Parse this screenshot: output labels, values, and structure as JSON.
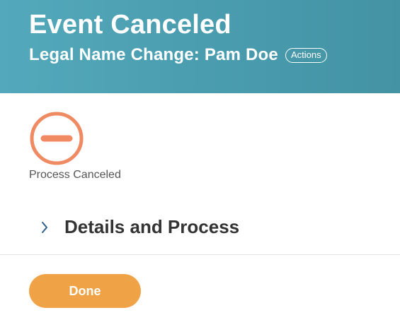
{
  "header": {
    "title": "Event Canceled",
    "subtitle": "Legal Name Change: Pam Doe",
    "actions_label": "Actions",
    "background_color": "#4a9daf"
  },
  "status": {
    "icon": "canceled-circle-icon",
    "icon_color": "#f08a63",
    "label": "Process Canceled"
  },
  "details": {
    "icon": "chevron-right-icon",
    "title": "Details and Process"
  },
  "footer": {
    "done_label": "Done",
    "done_color": "#f0a346"
  }
}
